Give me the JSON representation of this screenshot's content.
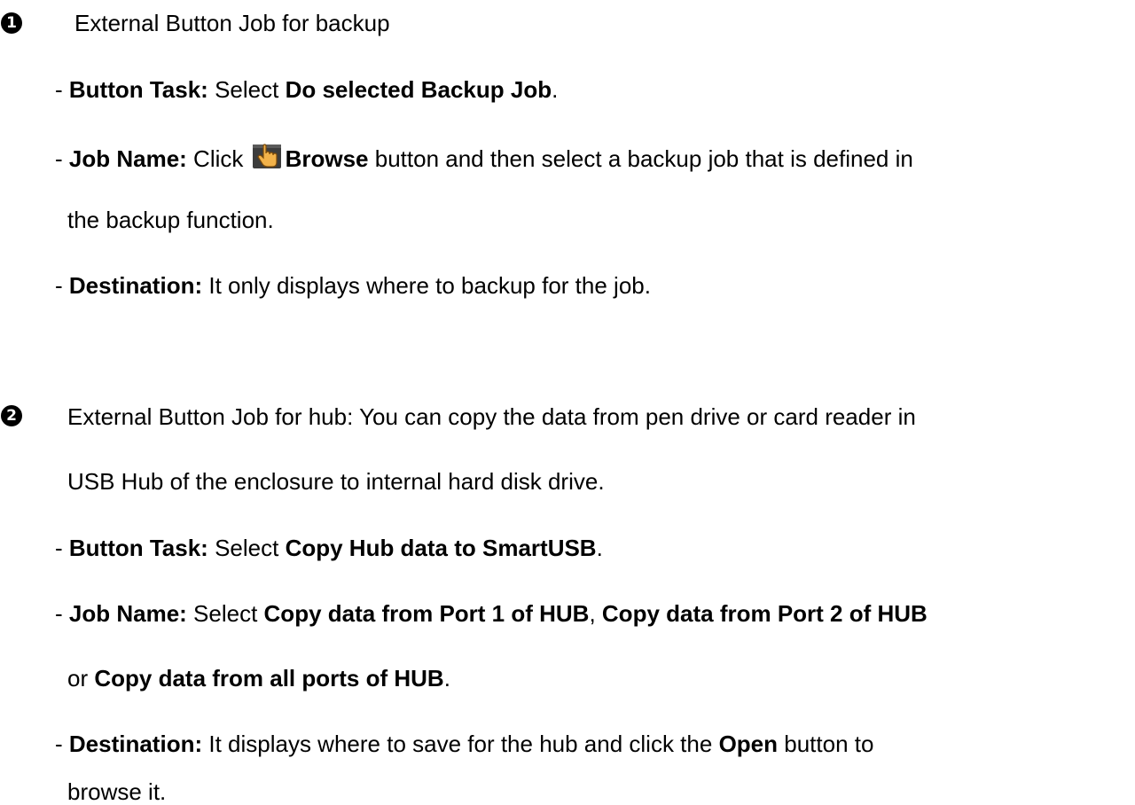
{
  "section1": {
    "number": "1",
    "number_icon": "circled-number-one-icon",
    "heading": "External Button Job for backup",
    "task": {
      "dash": "- ",
      "label": "Button Task:",
      "pre": " Select ",
      "value": "Do selected Backup Job",
      "post": "."
    },
    "job_name": {
      "dash": "- ",
      "label": "Job Name:",
      "pre": " Click ",
      "icon": "hand-pointer-icon",
      "button_label": "Browse",
      "post": " button and then select a backup job that is defined in",
      "continuation": "the backup function."
    },
    "destination": {
      "dash": "- ",
      "label": "Destination:",
      "text": " It only displays where to backup for the job."
    }
  },
  "section2": {
    "number": "2",
    "number_icon": "circled-number-two-icon",
    "heading": "External Button Job for hub: You can copy the data from pen drive or card reader in",
    "heading_continuation": "USB Hub of the enclosure to internal hard disk drive.",
    "task": {
      "dash": "- ",
      "label": "Button Task:",
      "pre": " Select ",
      "value": "Copy Hub data to SmartUSB",
      "post": "."
    },
    "job_name": {
      "dash": "- ",
      "label": "Job Name:",
      "pre": " Select ",
      "option1": "Copy data from Port 1 of HUB",
      "sep": ", ",
      "option2": "Copy data from Port 2 of HUB",
      "or": "or ",
      "option3": "Copy data from all ports of HUB",
      "post": "."
    },
    "destination": {
      "dash": "- ",
      "label": "Destination:",
      "pre": " It displays where to save for the hub and click the ",
      "button_label": "Open",
      "post": " button to",
      "continuation": "browse it."
    }
  }
}
